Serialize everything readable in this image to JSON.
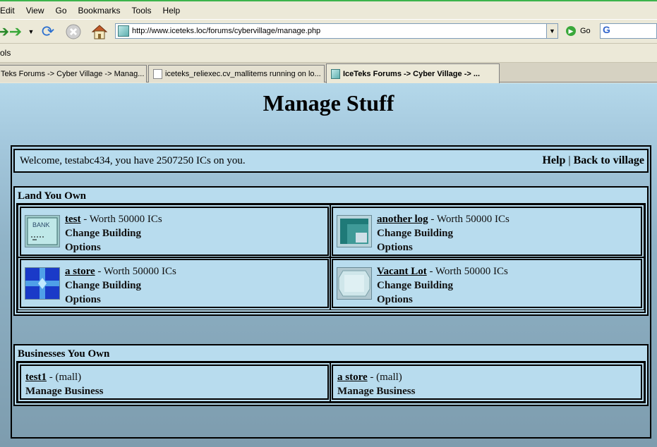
{
  "menubar": {
    "items": [
      "Edit",
      "View",
      "Go",
      "Bookmarks",
      "Tools",
      "Help"
    ]
  },
  "navbar": {
    "url": "http://www.iceteks.loc/forums/cybervillage/manage.php",
    "go_label": "Go",
    "search_value": "G"
  },
  "toolsbar": {
    "label": "ols"
  },
  "tabs": [
    {
      "label": "Teks Forums -> Cyber Village -> Manag..."
    },
    {
      "label": "iceteks_reliexec.cv_mallitems running on lo..."
    },
    {
      "label": "IceTeks Forums -> Cyber Village -> ..."
    }
  ],
  "page": {
    "title": "Manage Stuff",
    "welcome": "Welcome, testabc434, you have 2507250 ICs on you.",
    "help_link": "Help",
    "separator": "|",
    "back_link": "Back to village",
    "land_title": "Land You Own",
    "land": [
      {
        "name": "test",
        "worth": " - Worth 50000 ICs",
        "change": "Change Building",
        "options": "Options",
        "icon": "bank-icon"
      },
      {
        "name": "another log",
        "worth": " - Worth 50000 ICs",
        "change": "Change Building",
        "options": "Options",
        "icon": "teal-building-icon"
      },
      {
        "name": "a store",
        "worth": " - Worth 50000 ICs",
        "change": "Change Building",
        "options": "Options",
        "icon": "store-icon"
      },
      {
        "name": "Vacant Lot",
        "worth": " - Worth 50000 ICs",
        "change": "Change Building",
        "options": "Options",
        "icon": "vacant-lot-icon"
      }
    ],
    "biz_title": "Businesses You Own",
    "businesses": [
      {
        "name": "test1",
        "type": " - (mall)",
        "manage": "Manage Business"
      },
      {
        "name": "a store",
        "type": " - (mall)",
        "manage": "Manage Business"
      }
    ]
  },
  "colors": {
    "page_bg": "#b4d8ea",
    "cell_bg": "#b8dcee",
    "chrome_bg": "#ece9d8"
  }
}
